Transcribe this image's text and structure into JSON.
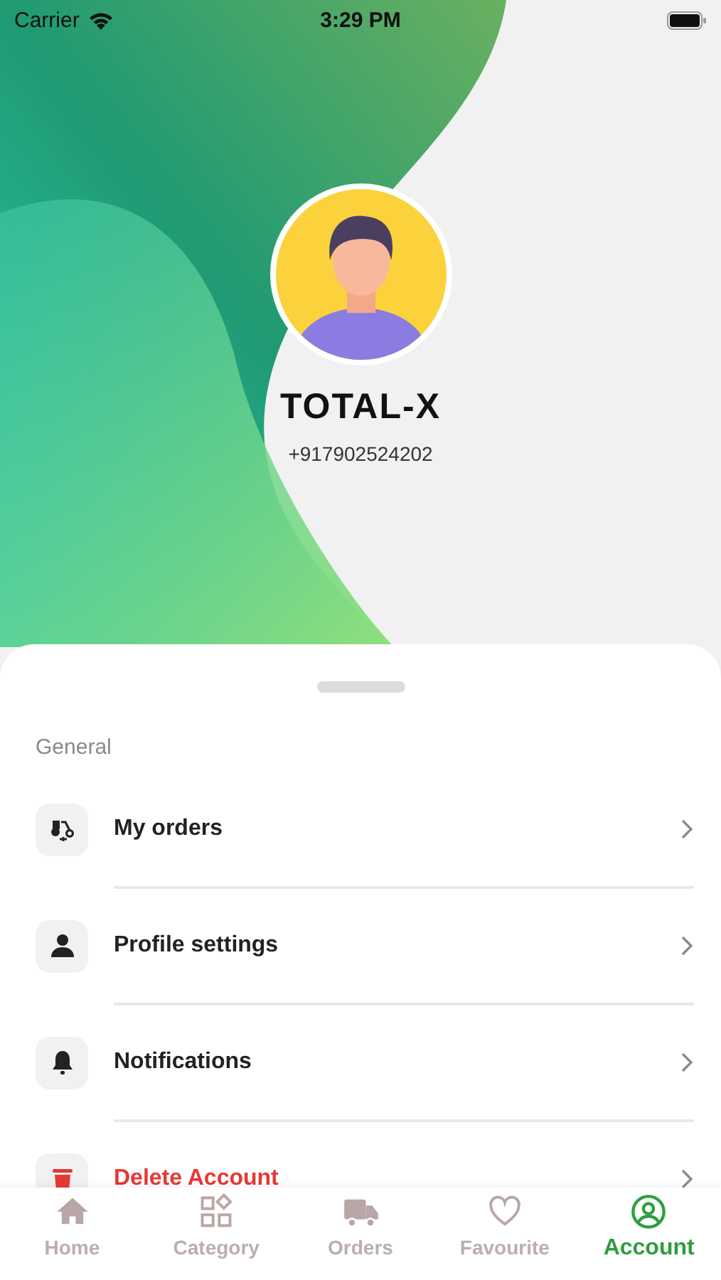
{
  "status_bar": {
    "carrier": "Carrier",
    "time": "3:29 PM"
  },
  "profile": {
    "name": "TOTAL-X",
    "phone": "+917902524202"
  },
  "section": {
    "title": "General"
  },
  "menu": [
    {
      "label": "My orders",
      "kind": "orders"
    },
    {
      "label": "Profile settings",
      "kind": "profile"
    },
    {
      "label": "Notifications",
      "kind": "notifications"
    },
    {
      "label": "Delete Account",
      "kind": "delete"
    }
  ],
  "tabs": [
    {
      "label": "Home",
      "kind": "home",
      "selected": false
    },
    {
      "label": "Category",
      "kind": "category",
      "selected": false
    },
    {
      "label": "Orders",
      "kind": "orders",
      "selected": false
    },
    {
      "label": "Favourite",
      "kind": "favourite",
      "selected": false
    },
    {
      "label": "Account",
      "kind": "account",
      "selected": true
    }
  ]
}
